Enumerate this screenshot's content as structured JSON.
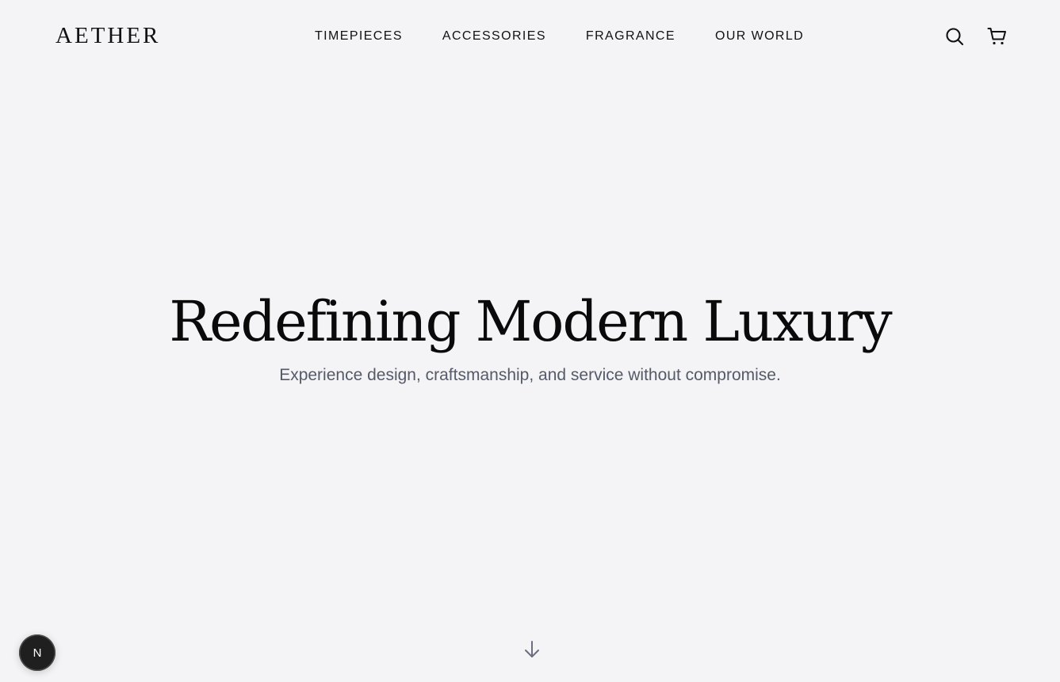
{
  "brand": {
    "logo": "AETHER"
  },
  "nav": {
    "items": [
      {
        "label": "TIMEPIECES"
      },
      {
        "label": "ACCESSORIES"
      },
      {
        "label": "FRAGRANCE"
      },
      {
        "label": "OUR WORLD"
      }
    ]
  },
  "header_actions": {
    "search_icon": "search-icon",
    "cart_icon": "cart-icon"
  },
  "hero": {
    "title": "Redefining Modern Luxury",
    "subtitle": "Experience design, craftsmanship, and service without compromise."
  },
  "scroll_indicator": {
    "icon": "arrow-down-icon"
  },
  "dev_badge": {
    "icon": "nextjs-logo-icon",
    "letter": "N"
  },
  "colors": {
    "background": "#f4f4f6",
    "text": "#111111",
    "subtitle": "#545a68",
    "badge": "#1f1f1f"
  }
}
